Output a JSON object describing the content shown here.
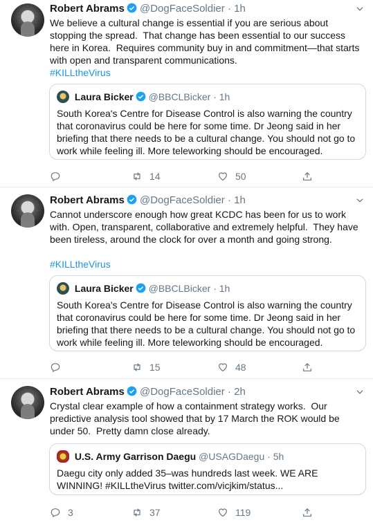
{
  "tweets": [
    {
      "author": "Robert Abrams",
      "handle": "@DogFaceSoldier",
      "sep": "·",
      "time": "1h",
      "text": "We believe a cultural change is essential if you are serious about stopping the spread.  That change has been essential to our success here in Korea.  Requires community buy in and commitment—that starts with open and transparent communications.",
      "hashtag": "#KILLtheVirus",
      "quote": {
        "author": "Laura Bicker",
        "handle": "@BBCLBicker",
        "sep": "·",
        "time": "1h",
        "text": "South Korea's Centre for Disease Control is also warning the country that coronavirus could be here for some time. Dr Jeong said in her briefing that there needs to be a cultural change. You should not go to work while feeling ill. More teleworking should be encouraged."
      },
      "reply_count": "",
      "retweet_count": "14",
      "like_count": "50"
    },
    {
      "author": "Robert Abrams",
      "handle": "@DogFaceSoldier",
      "sep": "·",
      "time": "1h",
      "text": "Cannot underscore enough how great KCDC has been for us to work with. Open, transparent, collaborative and extremely helpful.  They have been tireless, around the clock for over a month and going strong.",
      "hashtag": "#KILLtheVirus",
      "quote": {
        "author": "Laura Bicker",
        "handle": "@BBCLBicker",
        "sep": "·",
        "time": "1h",
        "text": "South Korea's Centre for Disease Control is also warning the country that coronavirus could be here for some time. Dr Jeong said in her briefing that there needs to be a cultural change. You should not go to work while feeling ill. More teleworking should be encouraged."
      },
      "reply_count": "",
      "retweet_count": "15",
      "like_count": "48"
    },
    {
      "author": "Robert Abrams",
      "handle": "@DogFaceSoldier",
      "sep": "·",
      "time": "2h",
      "text": "Crystal clear example of how a containment strategy works.  Our predictive analysis tool showed that by 17 March the ROK would be under 50.  Pretty damn close already.",
      "hashtag": "",
      "quote": {
        "author": "U.S. Army Garrison Daegu",
        "handle": "@USAGDaegu",
        "sep": "·",
        "time": "5h",
        "text": "Daegu city only added 35–was hundreds last week. WE ARE WINNING! #KILLtheVirus twitter.com/vicjkim/status..."
      },
      "reply_count": "3",
      "retweet_count": "37",
      "like_count": "119"
    }
  ],
  "colors": {
    "accent": "#1b95e0",
    "muted": "#657786",
    "border": "#e6ecf0"
  },
  "icons": [
    "verified-badge-icon",
    "caret-down-icon",
    "reply-icon",
    "retweet-icon",
    "like-icon",
    "share-icon"
  ]
}
